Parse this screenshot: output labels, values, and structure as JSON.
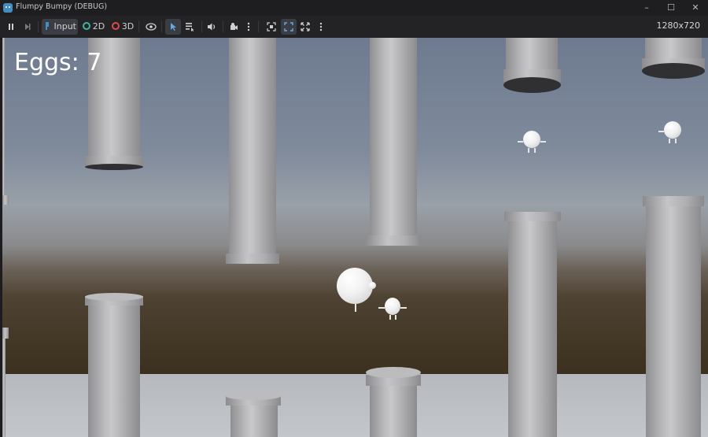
{
  "window": {
    "title": "Flumpy Bumpy (DEBUG)"
  },
  "toolbar": {
    "input_label": "Input",
    "mode_2d_label": "2D",
    "mode_3d_label": "3D",
    "resolution": "1280x720",
    "colors": {
      "mode_2d": "#3fb3a8",
      "mode_3d": "#e14a4a",
      "input": "#478cbf"
    }
  },
  "hud": {
    "score_label": "Eggs: 7"
  }
}
